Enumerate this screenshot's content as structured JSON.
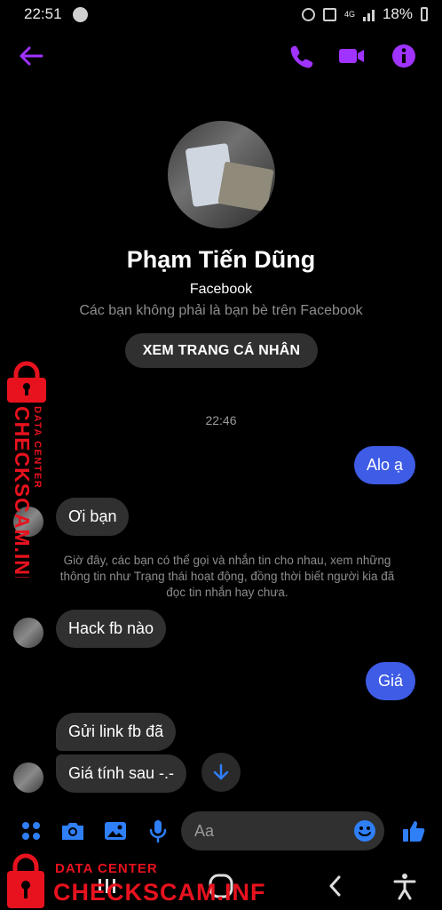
{
  "status_bar": {
    "time": "22:51",
    "network": "4G",
    "battery": "18%"
  },
  "header": {
    "back_icon": "arrow-left-icon",
    "call_icon": "phone-icon",
    "video_icon": "video-camera-icon",
    "info_icon": "info-icon",
    "accent_color": "#a033ff"
  },
  "profile": {
    "name": "Phạm Tiến Dũng",
    "platform": "Facebook",
    "relation": "Các bạn không phải là bạn bè trên Facebook",
    "view_profile_label": "XEM TRANG CÁ NHÂN"
  },
  "conversation": {
    "timestamp": "22:46",
    "messages": [
      {
        "from": "me",
        "text": "Alo ạ"
      },
      {
        "from": "them",
        "text": "Ơi bạn"
      },
      {
        "from": "system",
        "text": "Giờ đây, các bạn có thể gọi và nhắn tin cho nhau, xem những thông tin như Trạng thái hoạt động, đồng thời biết người kia đã đọc tin nhắn hay chưa."
      },
      {
        "from": "them",
        "text": "Hack fb nào"
      },
      {
        "from": "me",
        "text": "Giá"
      },
      {
        "from": "them",
        "text": "Gửi link fb đã"
      },
      {
        "from": "them",
        "text": "Giá tính sau -.-"
      }
    ],
    "outgoing_color": "#3f5ce6",
    "incoming_color": "#303030"
  },
  "composer": {
    "placeholder": "Aa",
    "icons": [
      "menu-dots-icon",
      "camera-icon",
      "image-icon",
      "microphone-icon",
      "emoji-icon",
      "thumbs-up-icon"
    ],
    "icon_color": "#2f7ff7"
  },
  "watermark": {
    "top": "DATA CENTER",
    "brand": "CHECKSCAM.INFO",
    "color": "#e8121e"
  }
}
